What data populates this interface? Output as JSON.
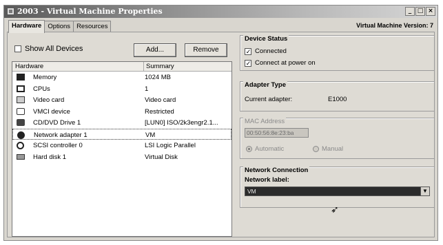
{
  "window": {
    "title": "2003 - Virtual Machine Properties",
    "buttons": [
      "_",
      "□",
      "×"
    ]
  },
  "tabs": [
    "Hardware",
    "Options",
    "Resources"
  ],
  "vm_version": "Virtual Machine Version: 7",
  "left": {
    "show_all_devices": "Show All Devices",
    "add_button": "Add...",
    "remove_button": "Remove",
    "columns": {
      "hardware": "Hardware",
      "summary": "Summary"
    },
    "devices": [
      {
        "icon": "memory-icon",
        "name": "Memory",
        "summary": "1024 MB"
      },
      {
        "icon": "cpu-icon",
        "name": "CPUs",
        "summary": "1"
      },
      {
        "icon": "video-card-icon",
        "name": "Video card",
        "summary": "Video card"
      },
      {
        "icon": "vmci-device-icon",
        "name": "VMCI device",
        "summary": "Restricted"
      },
      {
        "icon": "cd-dvd-icon",
        "name": "CD/DVD Drive 1",
        "summary": "[LUN0] ISO/2k3engr2.1..."
      },
      {
        "icon": "network-adapter-icon",
        "name": "Network adapter 1",
        "summary": "VM"
      },
      {
        "icon": "scsi-controller-icon",
        "name": "SCSI controller 0",
        "summary": "LSI Logic Parallel"
      },
      {
        "icon": "hard-disk-icon",
        "name": "Hard disk 1",
        "summary": "Virtual Disk"
      }
    ]
  },
  "right": {
    "device_status": {
      "label": "Device Status",
      "connected": "Connected",
      "connect_at_power_on": "Connect at power on"
    },
    "adapter_type": {
      "label": "Adapter Type",
      "current_adapter_label": "Current adapter:",
      "current_adapter_value": "E1000"
    },
    "mac_address": {
      "label": "MAC Address",
      "value": "00:50:56:8e:23:ba",
      "automatic": "Automatic",
      "manual": "Manual"
    },
    "network_connection": {
      "label": "Network Connection",
      "network_label": "Network label:",
      "selected": "VM"
    }
  }
}
